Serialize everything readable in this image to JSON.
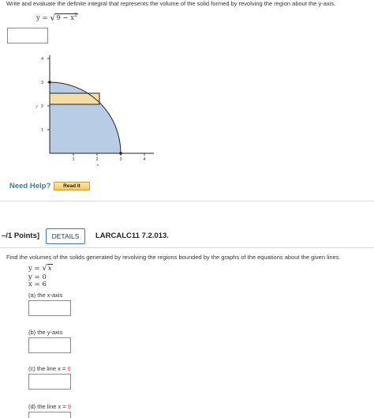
{
  "q1": {
    "prompt": "Write and evaluate the definite integral that represents the volume of the solid formed by revolving the region about the y-axis.",
    "equation": {
      "lhs": "y =",
      "radicand": "9 − x"
    }
  },
  "graph": {
    "y_ticks": [
      "4",
      "3",
      "2",
      "1"
    ],
    "y_label": "y",
    "x_ticks": [
      "1",
      "2",
      "3",
      "4"
    ],
    "x_label": "x",
    "colors": {
      "region": "#b9cce6",
      "strip": "#f3dfa6",
      "curve": "#222222"
    }
  },
  "help": {
    "label": "Need Help?",
    "button": "Read It"
  },
  "q2": {
    "points": "–/1 Points]",
    "details": "DETAILS",
    "code": "LARCALC11 7.2.013.",
    "prompt": "Find the volumes of the solids generated by revolving the regions bounded by the graphs of the equations about the given lines.",
    "equations": [
      {
        "lhs": "y =",
        "radicand": "x"
      },
      {
        "text": "y = 0"
      },
      {
        "text": "x = 6"
      }
    ],
    "parts": [
      {
        "label": "(a) the x-axis"
      },
      {
        "label": "(b) the y-axis"
      },
      {
        "label_prefix": "(c) the line x =",
        "value": "6"
      },
      {
        "label_prefix": "(d) the line x =",
        "value": "9"
      }
    ]
  }
}
